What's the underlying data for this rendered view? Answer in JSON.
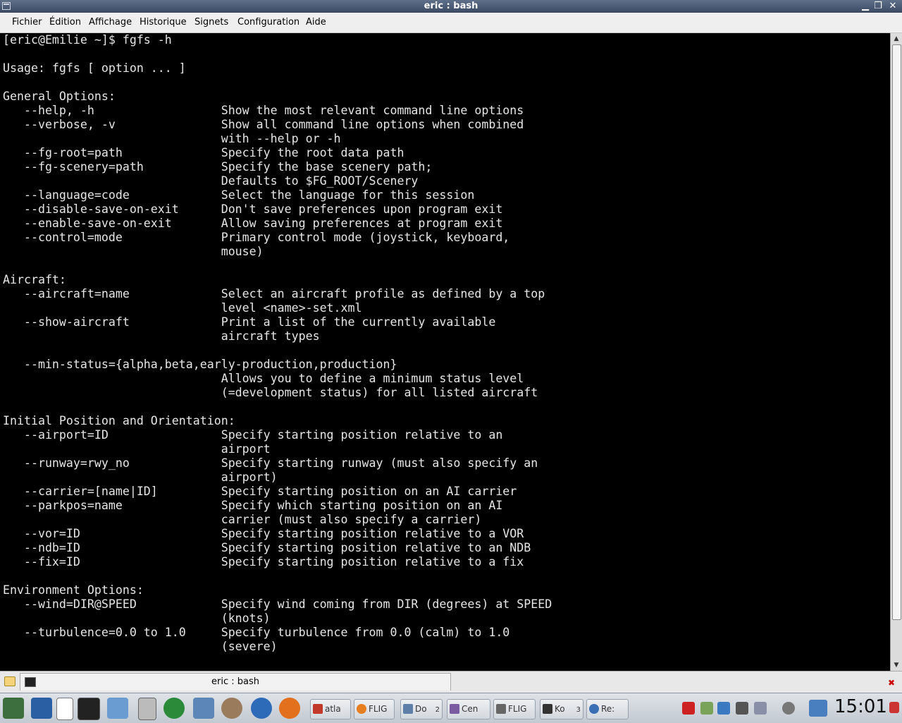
{
  "window": {
    "title": "eric : bash"
  },
  "menu": [
    "Fichier",
    "Édition",
    "Affichage",
    "Historique",
    "Signets",
    "Configuration",
    "Aide"
  ],
  "terminal": {
    "lines": [
      "[eric@Emilie ~]$ fgfs -h",
      "",
      "Usage: fgfs [ option ... ]",
      "",
      "General Options:",
      "   --help, -h                  Show the most relevant command line options",
      "   --verbose, -v               Show all command line options when combined",
      "                               with --help or -h",
      "   --fg-root=path              Specify the root data path",
      "   --fg-scenery=path           Specify the base scenery path;",
      "                               Defaults to $FG_ROOT/Scenery",
      "   --language=code             Select the language for this session",
      "   --disable-save-on-exit      Don't save preferences upon program exit",
      "   --enable-save-on-exit       Allow saving preferences at program exit",
      "   --control=mode              Primary control mode (joystick, keyboard,",
      "                               mouse)",
      "",
      "Aircraft:",
      "   --aircraft=name             Select an aircraft profile as defined by a top",
      "                               level <name>-set.xml",
      "   --show-aircraft             Print a list of the currently available",
      "                               aircraft types",
      "",
      "   --min-status={alpha,beta,early-production,production}",
      "                               Allows you to define a minimum status level",
      "                               (=development status) for all listed aircraft",
      "",
      "Initial Position and Orientation:",
      "   --airport=ID                Specify starting position relative to an",
      "                               airport",
      "   --runway=rwy_no             Specify starting runway (must also specify an",
      "                               airport)",
      "   --carrier=[name|ID]         Specify starting position on an AI carrier",
      "   --parkpos=name              Specify which starting position on an AI",
      "                               carrier (must also specify a carrier)",
      "   --vor=ID                    Specify starting position relative to a VOR",
      "   --ndb=ID                    Specify starting position relative to an NDB",
      "   --fix=ID                    Specify starting position relative to a fix",
      "",
      "Environment Options:",
      "   --wind=DIR@SPEED            Specify wind coming from DIR (degrees) at SPEED",
      "                               (knots)",
      "   --turbulence=0.0 to 1.0     Specify turbulence from 0.0 (calm) to 1.0",
      "                               (severe)"
    ]
  },
  "tabbar": {
    "active_tab": "eric : bash"
  },
  "taskbar": {
    "tasks": [
      {
        "label": "atla",
        "icon": "pdf-icon",
        "color": "#c0392b"
      },
      {
        "label": "FLIG",
        "icon": "firefox-icon",
        "color": "#e67e22"
      },
      {
        "label": "Do",
        "count": "2",
        "icon": "document-icon",
        "color": "#5d7fa8"
      },
      {
        "label": "Cen",
        "icon": "control-center-icon",
        "color": "#7a5aa0"
      },
      {
        "label": "FLIG",
        "icon": "plane-icon",
        "color": "#666666"
      },
      {
        "label": "Ko",
        "count": "3",
        "icon": "konsole-icon",
        "color": "#333333"
      },
      {
        "label": "Re:",
        "icon": "mail-icon",
        "color": "#3b6fb5"
      }
    ],
    "clock": "15:01"
  }
}
